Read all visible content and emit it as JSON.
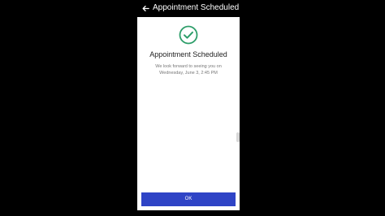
{
  "header": {
    "title": "Appointment Scheduled",
    "back_icon": "arrow-left-icon"
  },
  "confirmation": {
    "icon": "check-circle-icon",
    "icon_color": "#2e9e6a",
    "title": "Appointment Scheduled",
    "message_line1": "We look forward to seeing you on",
    "message_line2": "Wednesday, June 3, 2:45 PM"
  },
  "actions": {
    "ok_label": "OK",
    "ok_color": "#2f44c6"
  }
}
